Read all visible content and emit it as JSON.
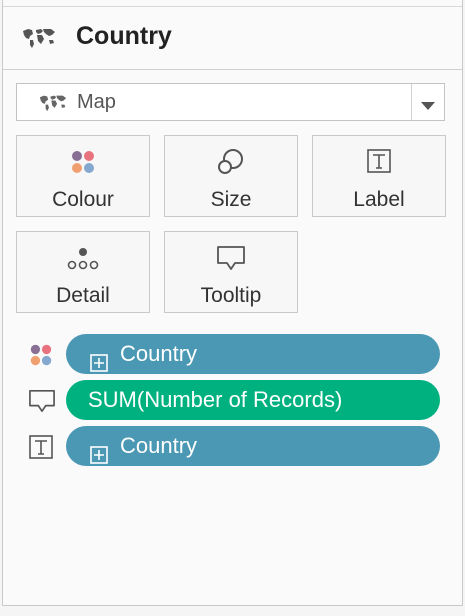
{
  "header": {
    "title": "Country",
    "icon": "world-map-icon"
  },
  "mark_type": {
    "selected": "Map",
    "icon": "world-map-icon",
    "dropdown_icon": "chevron-down-icon"
  },
  "cards": [
    {
      "label": "Colour",
      "icon": "colour-dots-icon"
    },
    {
      "label": "Size",
      "icon": "size-icon"
    },
    {
      "label": "Label",
      "icon": "text-label-icon"
    },
    {
      "label": "Detail",
      "icon": "detail-dots-icon"
    },
    {
      "label": "Tooltip",
      "icon": "tooltip-icon"
    }
  ],
  "fields": [
    {
      "type": "colour",
      "label": "Country",
      "icon": "colour-dots-icon",
      "expandable": true,
      "kind": "dimension"
    },
    {
      "type": "tooltip",
      "label": "SUM(Number of Records)",
      "icon": "tooltip-icon",
      "expandable": false,
      "kind": "measure"
    },
    {
      "type": "label",
      "label": "Country",
      "icon": "text-label-icon",
      "expandable": true,
      "kind": "dimension"
    }
  ],
  "colors": {
    "dimension_pill": "#4b98b4",
    "measure_pill": "#00b180",
    "dot_purple": "#8a6f94",
    "dot_red": "#e8737f",
    "dot_orange": "#f0a070",
    "dot_blue": "#84a8cf"
  }
}
